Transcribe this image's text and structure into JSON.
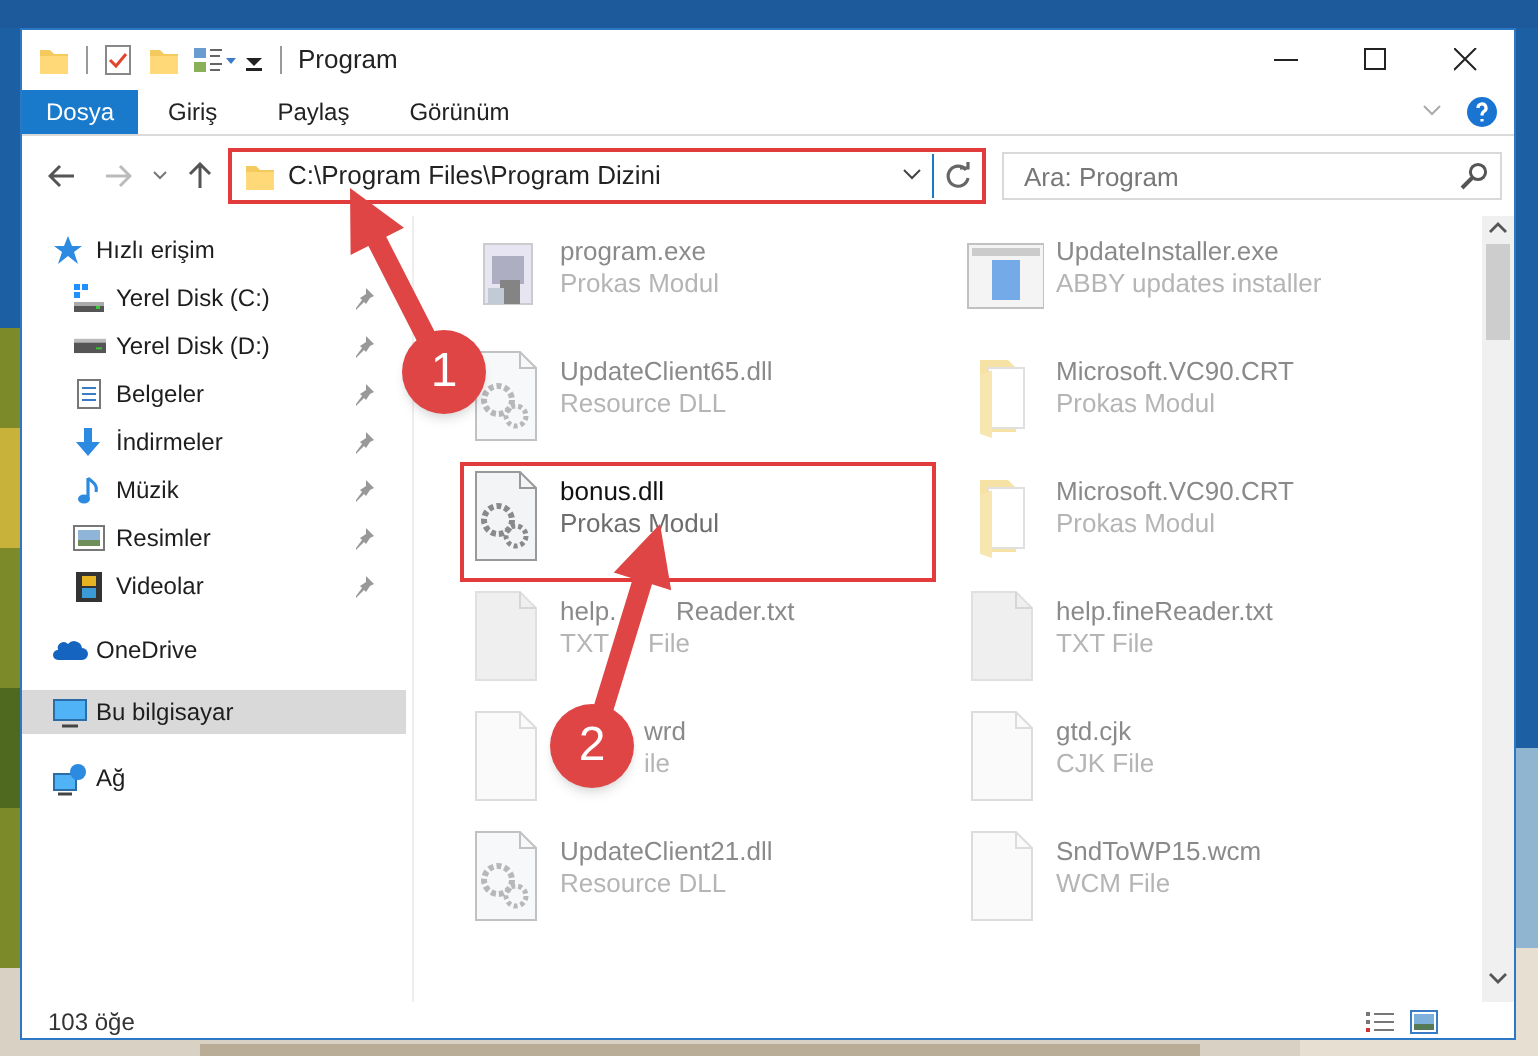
{
  "window": {
    "title": "Program"
  },
  "ribbon": {
    "tabs": [
      {
        "label": "Dosya",
        "kind": "file_menu",
        "selected": false
      },
      {
        "label": "Giriş",
        "kind": "tab",
        "selected": false
      },
      {
        "label": "Paylaş",
        "kind": "tab",
        "selected": false
      },
      {
        "label": "Görünüm",
        "kind": "tab",
        "selected": false
      }
    ]
  },
  "address_bar": {
    "path": "C:\\Program Files\\Program Dizini"
  },
  "search": {
    "placeholder": "Ara: Program"
  },
  "navigation": [
    {
      "label": "Hızlı erişim",
      "kind": "star",
      "selected": false,
      "children": [
        {
          "label": "Yerel Disk (C:)",
          "kind": "drive_c",
          "pinned": true,
          "selected": false
        },
        {
          "label": "Yerel Disk (D:)",
          "kind": "drive",
          "pinned": true,
          "selected": false
        },
        {
          "label": "Belgeler",
          "kind": "documents",
          "pinned": true,
          "selected": false
        },
        {
          "label": "İndirmeler",
          "kind": "downloads",
          "pinned": true,
          "selected": false
        },
        {
          "label": "Müzik",
          "kind": "music",
          "pinned": true,
          "selected": false
        },
        {
          "label": "Resimler",
          "kind": "pictures",
          "pinned": true,
          "selected": false
        },
        {
          "label": "Videolar",
          "kind": "videos",
          "pinned": true,
          "selected": false
        }
      ]
    },
    {
      "label": "OneDrive",
      "kind": "cloud",
      "selected": false
    },
    {
      "label": "Bu bilgisayar",
      "kind": "computer",
      "selected": true
    },
    {
      "label": "Ağ",
      "kind": "network",
      "selected": false
    }
  ],
  "files": [
    {
      "name_parts": [
        "program.exe"
      ],
      "type_parts": [
        "Prokas Modul"
      ],
      "kind": "app",
      "highlighted": false,
      "covered": false
    },
    {
      "name_parts": [
        "UpdateInstaller.exe"
      ],
      "type_parts": [
        "ABBY updates installer"
      ],
      "kind": "installer",
      "highlighted": false,
      "covered": false
    },
    {
      "name_parts": [
        "UpdateClient65.dll"
      ],
      "type_parts": [
        "Resource DLL"
      ],
      "kind": "dll",
      "highlighted": false,
      "covered": false
    },
    {
      "name_parts": [
        "Microsoft.VC90.CRT"
      ],
      "type_parts": [
        "Prokas Modul"
      ],
      "kind": "folder",
      "highlighted": false,
      "covered": false
    },
    {
      "name_parts": [
        "bonus.dll"
      ],
      "type_parts": [
        "Prokas Modul"
      ],
      "kind": "dll",
      "highlighted": true,
      "covered": false
    },
    {
      "name_parts": [
        "Microsoft.VC90.CRT"
      ],
      "type_parts": [
        "Prokas Modul"
      ],
      "kind": "folder",
      "highlighted": false,
      "covered": false
    },
    {
      "name_parts": [
        "help.",
        "Reader.txt"
      ],
      "type_parts": [
        "TXT",
        "File"
      ],
      "kind": "text",
      "highlighted": false,
      "covered": true
    },
    {
      "name_parts": [
        "help.fineReader.txt"
      ],
      "type_parts": [
        "TXT File"
      ],
      "kind": "text",
      "highlighted": false,
      "covered": false
    },
    {
      "name_parts": [
        "wrd"
      ],
      "type_parts": [
        "ile"
      ],
      "kind": "blank",
      "highlighted": false,
      "covered": true
    },
    {
      "name_parts": [
        "gtd.cjk"
      ],
      "type_parts": [
        "CJK File"
      ],
      "kind": "blank",
      "highlighted": false,
      "covered": false
    },
    {
      "name_parts": [
        "UpdateClient21.dll"
      ],
      "type_parts": [
        "Resource DLL"
      ],
      "kind": "dll",
      "highlighted": false,
      "covered": false
    },
    {
      "name_parts": [
        "SndToWP15.wcm"
      ],
      "type_parts": [
        "WCM File"
      ],
      "kind": "blank",
      "highlighted": false,
      "covered": false
    }
  ],
  "status_bar": {
    "count": "103 öğe"
  },
  "callouts": [
    {
      "number": "1"
    },
    {
      "number": "2"
    }
  ]
}
